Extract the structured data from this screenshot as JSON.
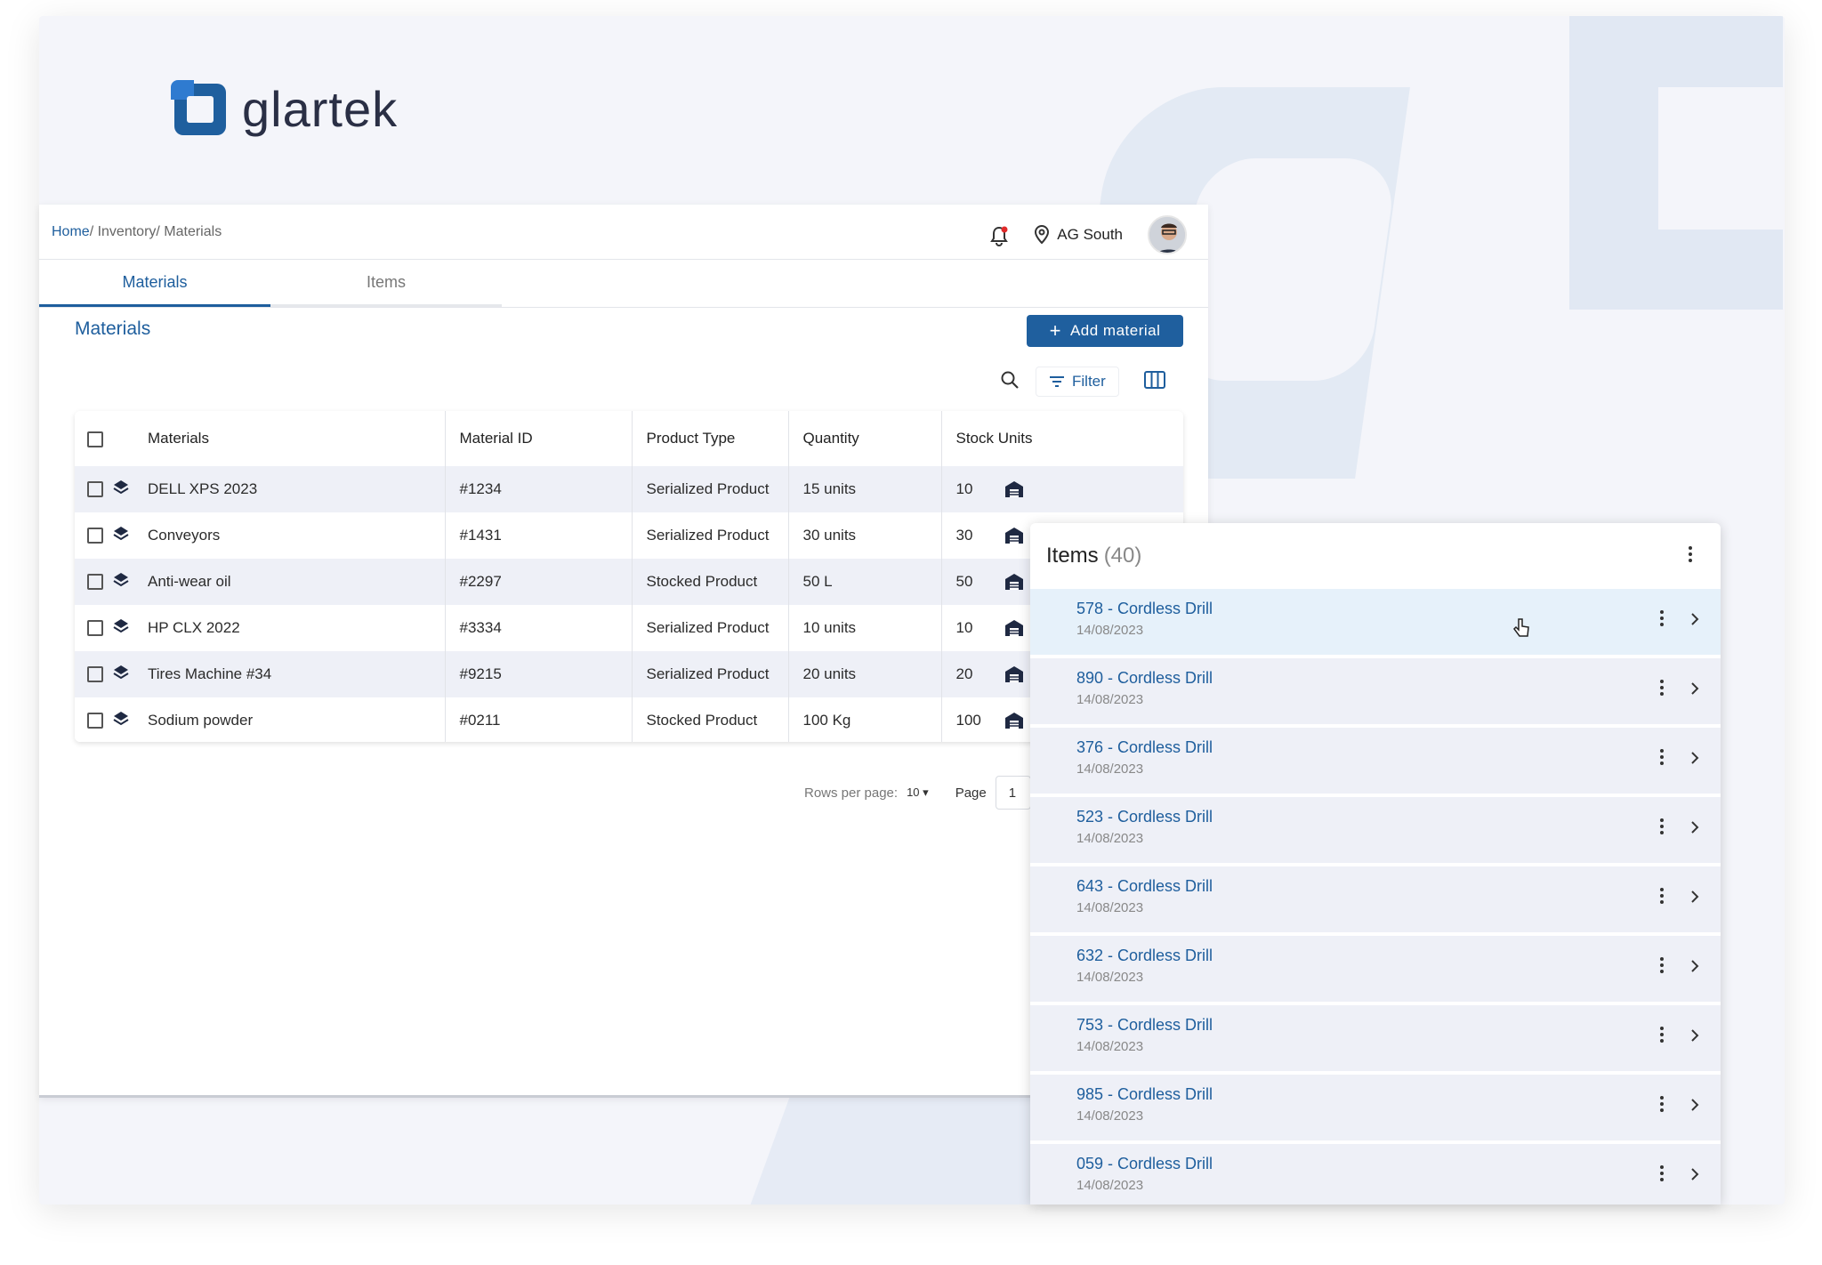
{
  "brand": {
    "logo_text": "glartek"
  },
  "breadcrumb": {
    "home": "Home",
    "rest": "/ Inventory/ Materials"
  },
  "header": {
    "location": "AG South"
  },
  "tabs": [
    {
      "label": "Materials",
      "active": true
    },
    {
      "label": "Items",
      "active": false
    }
  ],
  "section_title": "Materials",
  "add_button": "Add material",
  "toolbar": {
    "filter_label": "Filter"
  },
  "table": {
    "headers": [
      "Materials",
      "Material ID",
      "Product Type",
      "Quantity",
      "Stock Units"
    ],
    "rows": [
      {
        "name": "DELL XPS 2023",
        "id": "#1234",
        "type": "Serialized Product",
        "qty": "15 units",
        "stock": "10"
      },
      {
        "name": "Conveyors",
        "id": "#1431",
        "type": "Serialized Product",
        "qty": "30 units",
        "stock": "30"
      },
      {
        "name": "Anti-wear oil",
        "id": "#2297",
        "type": "Stocked Product",
        "qty": "50 L",
        "stock": "50"
      },
      {
        "name": "HP CLX 2022",
        "id": "#3334",
        "type": "Serialized Product",
        "qty": "10 units",
        "stock": "10"
      },
      {
        "name": "Tires Machine #34",
        "id": "#9215",
        "type": "Serialized Product",
        "qty": "20 units",
        "stock": "20"
      },
      {
        "name": "Sodium powder",
        "id": "#0211",
        "type": "Stocked Product",
        "qty": "100 Kg",
        "stock": "100"
      }
    ]
  },
  "pager": {
    "rows_label": "Rows per page:",
    "rows_value": "10",
    "page_label": "Page",
    "page_value": "1"
  },
  "items_panel": {
    "title": "Items",
    "count": "(40)",
    "items": [
      {
        "title": "578 - Cordless Drill",
        "date": "14/08/2023"
      },
      {
        "title": "890 - Cordless Drill",
        "date": "14/08/2023"
      },
      {
        "title": "376 - Cordless Drill",
        "date": "14/08/2023"
      },
      {
        "title": "523 - Cordless Drill",
        "date": "14/08/2023"
      },
      {
        "title": "643 - Cordless Drill",
        "date": "14/08/2023"
      },
      {
        "title": "632 - Cordless Drill",
        "date": "14/08/2023"
      },
      {
        "title": "753 - Cordless Drill",
        "date": "14/08/2023"
      },
      {
        "title": "985 - Cordless Drill",
        "date": "14/08/2023"
      },
      {
        "title": "059 - Cordless Drill",
        "date": "14/08/2023"
      }
    ]
  },
  "icons": {
    "bell": "bell-icon",
    "location": "location-pin-icon",
    "search": "search-icon",
    "filter": "filter-icon",
    "columns": "columns-icon",
    "layers": "layers-icon",
    "warehouse": "warehouse-icon",
    "more": "more-vertical-icon",
    "chevron": "chevron-right-icon"
  },
  "colors": {
    "primary": "#1f5f9e",
    "link": "#1e5e9d",
    "row_alt": "#eef0f7",
    "selected": "#e6f1fa"
  }
}
